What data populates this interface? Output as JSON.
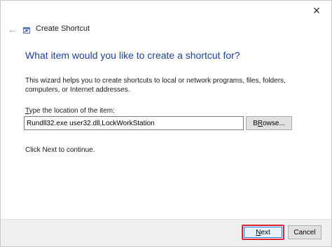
{
  "window": {
    "close_glyph": "✕",
    "back_glyph": "←"
  },
  "header": {
    "title": "Create Shortcut",
    "icon": "shortcut-icon"
  },
  "main": {
    "heading": "What item would you like to create a shortcut for?",
    "intro": "This wizard helps you to create shortcuts to local or network programs, files, folders, computers, or Internet addresses.",
    "location_label_mnemonic": "T",
    "location_label_rest": "ype the location of the item:",
    "location_value": "Rundll32.exe user32.dll,LockWorkStation",
    "browse_mnemonic": "R",
    "browse_rest": "owse...",
    "browse_prefix": "B",
    "continue_text": "Click Next to continue."
  },
  "footer": {
    "next_mnemonic": "N",
    "next_rest": "ext",
    "cancel_label": "Cancel"
  },
  "colors": {
    "heading": "#1f3f9a",
    "next_highlight": "#d9232e",
    "footer_bg": "#f0f0f0"
  }
}
